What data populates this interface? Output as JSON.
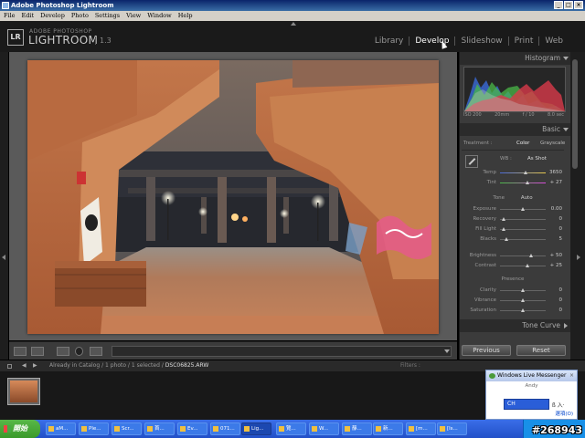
{
  "window": {
    "title": "Adobe Photoshop Lightroom"
  },
  "menu": [
    "File",
    "Edit",
    "Develop",
    "Photo",
    "Settings",
    "View",
    "Window",
    "Help"
  ],
  "header": {
    "logo_abbr": "LR",
    "brand_top": "ADOBE PHOTOSHOP",
    "brand_main": "LIGHTROOM",
    "version": "1.3",
    "modules": [
      "Library",
      "Develop",
      "Slideshow",
      "Print",
      "Web"
    ],
    "active_module": "Develop"
  },
  "right_panel": {
    "histogram_title": "Histogram",
    "histogram_info": {
      "iso": "ISO 200",
      "focal": "20mm",
      "aperture": "f / 10",
      "shutter": "8.0 sec"
    },
    "basic_title": "Basic",
    "treatment_label": "Treatment :",
    "treatment_color": "Color",
    "treatment_grayscale": "Grayscale",
    "wb_label": "WB :",
    "wb_value": "As Shot",
    "temp": {
      "label": "Temp",
      "value": "3650",
      "pos": 0.55
    },
    "tint": {
      "label": "Tint",
      "value": "+ 27",
      "pos": 0.6
    },
    "tone_label": "Tone",
    "auto_label": "Auto",
    "tone_rows": [
      {
        "label": "Exposure",
        "value": "0.00",
        "pos": 0.5
      },
      {
        "label": "Recovery",
        "value": "0",
        "pos": 0.05
      },
      {
        "label": "Fill Light",
        "value": "0",
        "pos": 0.05
      },
      {
        "label": "Blacks",
        "value": "5",
        "pos": 0.1
      },
      {
        "label": "Brightness",
        "value": "+ 50",
        "pos": 0.7
      },
      {
        "label": "Contrast",
        "value": "+ 25",
        "pos": 0.62
      }
    ],
    "presence_label": "Presence",
    "presence_rows": [
      {
        "label": "Clarity",
        "value": "0",
        "pos": 0.5
      },
      {
        "label": "Vibrance",
        "value": "0",
        "pos": 0.5
      },
      {
        "label": "Saturation",
        "value": "0",
        "pos": 0.5
      }
    ],
    "tone_curve_title": "Tone Curve",
    "previous_button": "Previous",
    "reset_button": "Reset"
  },
  "filmstrip": {
    "path_text": "Already in Catalog / 1 photo / 1 selected /",
    "filename": "DSC06825.ARW",
    "filters_label": "Filters :"
  },
  "messenger": {
    "title": "Windows Live Messenger",
    "body_text": "Andy",
    "ime_text": "CH",
    "ime_extra": "ß 入·",
    "link_text": "選項(O)"
  },
  "taskbar": {
    "start_label": "開始",
    "buttons": [
      "aM...",
      "Ple...",
      "Scr...",
      "首...",
      "Ev...",
      "071...",
      "Lig...",
      "覽...",
      "W...",
      "靜...",
      "新...",
      "[m...",
      "[ls..."
    ],
    "active_index": 6
  },
  "watermark": "#268943",
  "colors": {
    "accent": "#0a246a",
    "panel": "#3b3b3b",
    "canvas": "#5a5a5a"
  }
}
